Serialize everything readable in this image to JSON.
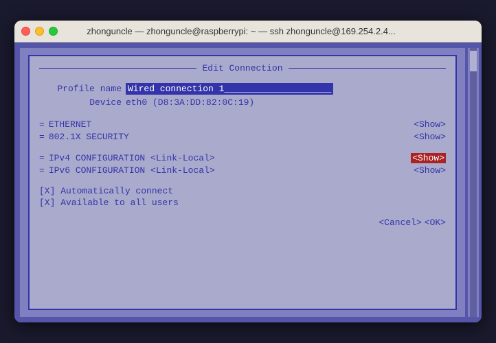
{
  "titlebar": {
    "title": "zhonguncle — zhonguncle@raspberrypi: ~ — ssh zhonguncle@169.254.2.4..."
  },
  "dialog": {
    "title": "Edit Connection",
    "profile_name_label": "Profile name",
    "profile_name_value": "Wired connection 1____________________",
    "device_label": "Device",
    "device_value": "eth0 (D8:3A:DD:82:0C:19)",
    "sections": [
      {
        "icon": "=",
        "label": "ETHERNET",
        "show": "<Show>"
      },
      {
        "icon": "=",
        "label": "802.1X SECURITY",
        "show": "<Show>"
      },
      {
        "icon": "=",
        "label": "IPv4 CONFIGURATION",
        "sublabel": "<Link-Local>",
        "show": "<Show>",
        "active": true
      },
      {
        "icon": "=",
        "label": "IPv6 CONFIGURATION",
        "sublabel": "<Link-Local>",
        "show": "<Show>",
        "active": false
      }
    ],
    "checkboxes": [
      "[X] Automatically connect",
      "[X] Available to all users"
    ],
    "cancel_button": "<Cancel>",
    "ok_button": "<OK>"
  }
}
